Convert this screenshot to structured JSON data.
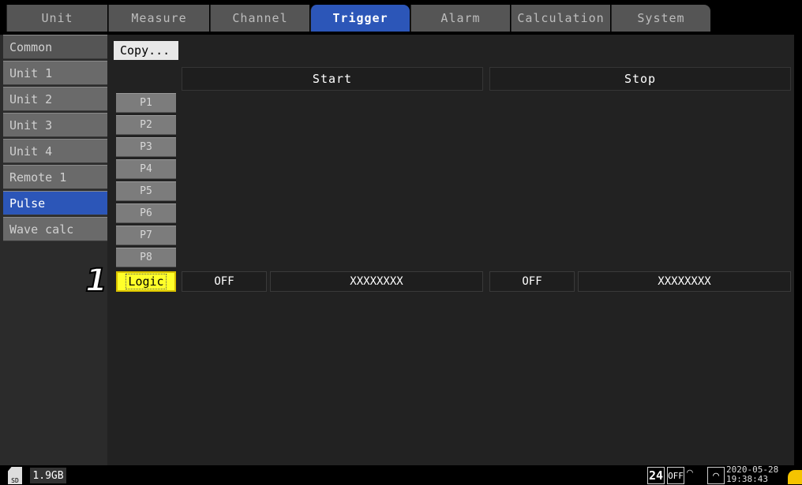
{
  "tabs": [
    {
      "label": "Unit",
      "active": false
    },
    {
      "label": "Measure",
      "active": false
    },
    {
      "label": "Channel",
      "active": false
    },
    {
      "label": "Trigger",
      "active": true
    },
    {
      "label": "Alarm",
      "active": false
    },
    {
      "label": "Calculation",
      "active": false
    },
    {
      "label": "System",
      "active": false
    }
  ],
  "sidebar": {
    "items": [
      {
        "label": "Common"
      },
      {
        "label": "Unit 1"
      },
      {
        "label": "Unit 2"
      },
      {
        "label": "Unit 3"
      },
      {
        "label": "Unit 4"
      },
      {
        "label": "Remote 1"
      },
      {
        "label": "Pulse",
        "active": true
      },
      {
        "label": "Wave calc"
      }
    ]
  },
  "main": {
    "copy_button": "Copy...",
    "columns": {
      "start": "Start",
      "stop": "Stop"
    },
    "channels": [
      "P1",
      "P2",
      "P3",
      "P4",
      "P5",
      "P6",
      "P7",
      "P8"
    ],
    "logic_row": {
      "label": "Logic",
      "start_state": "OFF",
      "start_value": "XXXXXXXX",
      "stop_state": "OFF",
      "stop_value": "XXXXXXXX"
    }
  },
  "callout": "1",
  "statusbar": {
    "media_icon": "sd-card-icon",
    "media_label": "SD",
    "free_space": "1.9GB",
    "badge_24": "24",
    "badge_off": "OFF",
    "date": "2020-05-28",
    "time": "19:38:43",
    "accent": "#f5c400"
  },
  "colors": {
    "active_tab": "#2c56b8",
    "logic_highlight": "#ffff2a"
  }
}
